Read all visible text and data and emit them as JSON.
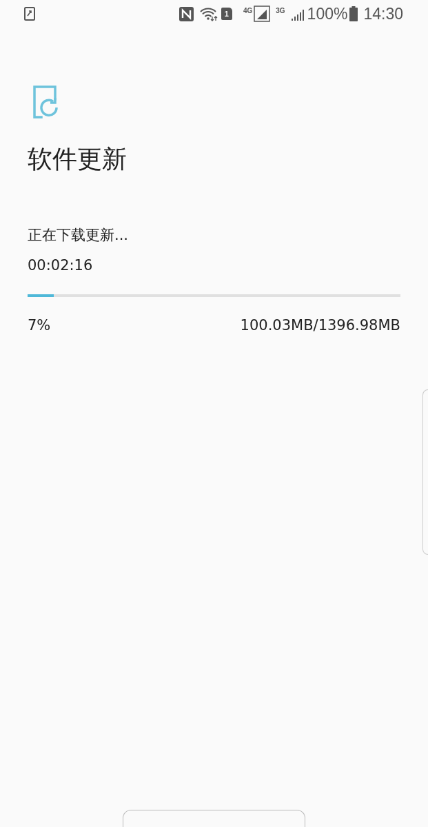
{
  "status_bar": {
    "sim_slot": "1",
    "network_1": "4G",
    "network_2": "3G",
    "battery": "100%",
    "time": "14:30"
  },
  "title": "软件更新",
  "download": {
    "status": "正在下载更新...",
    "elapsed": "00:02:16",
    "level": 0.07,
    "percent": "7%",
    "size": "100.03MB/1396.98MB"
  }
}
